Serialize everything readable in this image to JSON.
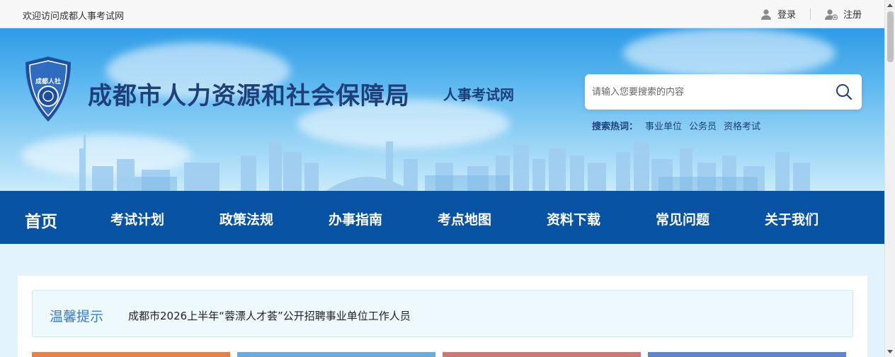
{
  "topbar": {
    "welcome": "欢迎访问成都人事考试网",
    "login": "登录",
    "register": "注册"
  },
  "header": {
    "logo_text": "成都人社",
    "org_name": "成都市人力资源和社会保障局",
    "site_name": "人事考试网",
    "search_placeholder": "请输入您要搜索的内容",
    "hot_label": "搜索热词：",
    "hot_words": [
      "事业单位",
      "公务员",
      "资格考试"
    ]
  },
  "nav": {
    "items": [
      "首页",
      "考试计划",
      "政策法规",
      "办事指南",
      "考点地图",
      "资料下载",
      "常见问题",
      "关于我们"
    ]
  },
  "notice": {
    "title": "温馨提示",
    "text": "成都市2026上半年“蓉漂人才荟”公开招聘事业单位工作人员"
  },
  "colors": {
    "nav_bg": "#0752a3",
    "title_color": "#1d3f7a",
    "tab_colors": [
      "#e0834d",
      "#6fa9d4",
      "#c77b74",
      "#5f86c6"
    ]
  }
}
